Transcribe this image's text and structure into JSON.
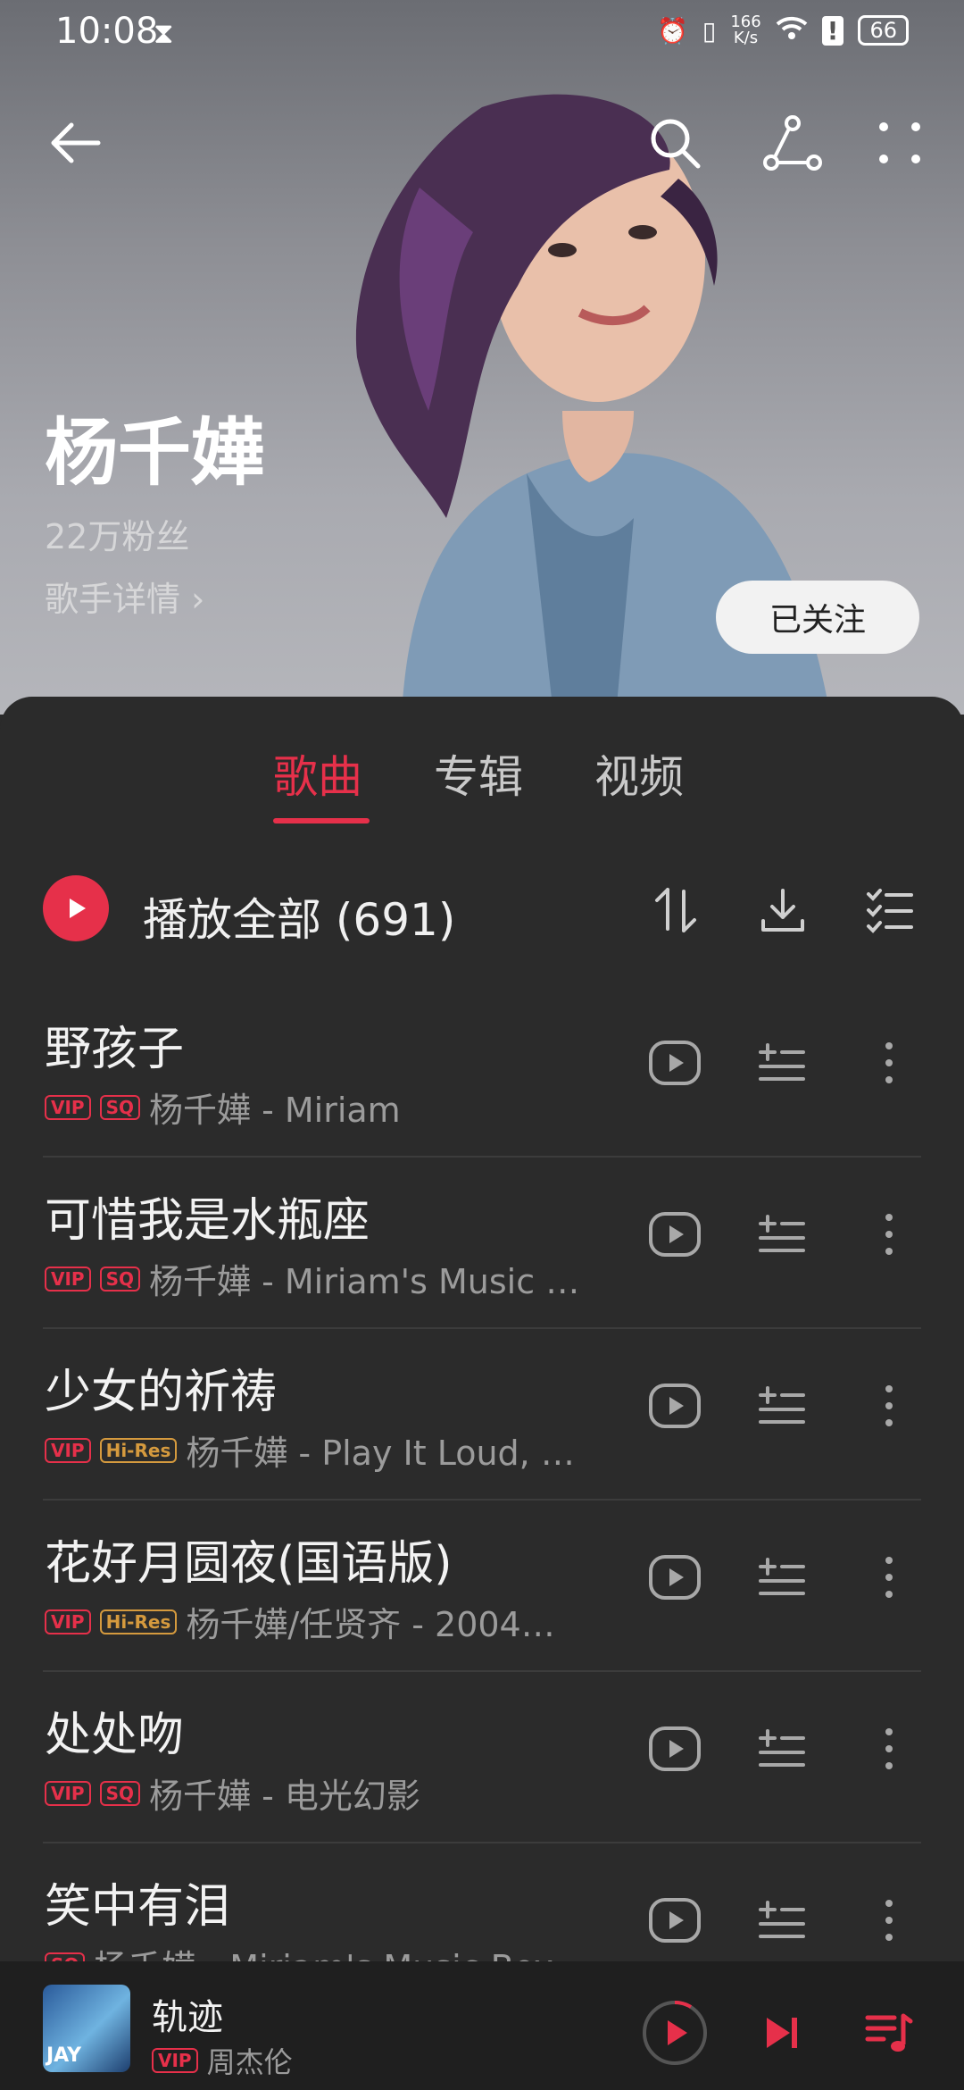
{
  "status_bar": {
    "time": "10:08",
    "net_speed_value": "166",
    "net_speed_unit": "K/s",
    "battery": "66"
  },
  "artist": {
    "name": "杨千嬅",
    "fans": "22万粉丝",
    "detail_link": "歌手详情 ›",
    "follow_label": "已关注"
  },
  "tabs": [
    {
      "label": "歌曲"
    },
    {
      "label": "专辑"
    },
    {
      "label": "视频"
    }
  ],
  "play_all": {
    "label": "播放全部 (691)"
  },
  "songs": [
    {
      "title": "野孩子",
      "badges": [
        "VIP",
        "SQ"
      ],
      "subtitle": "杨千嬅 - Miriam"
    },
    {
      "title": "可惜我是水瓶座",
      "badges": [
        "VIP",
        "SQ"
      ],
      "subtitle": "杨千嬅 - Miriam's Music …"
    },
    {
      "title": "少女的祈祷",
      "badges": [
        "VIP",
        "Hi-Res"
      ],
      "subtitle": "杨千嬅 - Play It Loud, …"
    },
    {
      "title": "花好月圆夜(国语版)",
      "badges": [
        "VIP",
        "Hi-Res"
      ],
      "subtitle": "杨千嬅/任贤齐 - 2004…"
    },
    {
      "title": "处处吻",
      "badges": [
        "VIP",
        "SQ"
      ],
      "subtitle": "杨千嬅 - 电光幻影"
    },
    {
      "title": "笑中有泪",
      "badges": [
        "SQ"
      ],
      "subtitle": "杨千嬅 - Miriam's Music Box"
    }
  ],
  "mini_player": {
    "title": "轨迹",
    "badge": "VIP",
    "artist": "周杰伦",
    "cover_text": "JAY"
  },
  "colors": {
    "accent": "#e6304a",
    "hires": "#d59a3e",
    "sheet_bg": "#2b2b2b"
  }
}
